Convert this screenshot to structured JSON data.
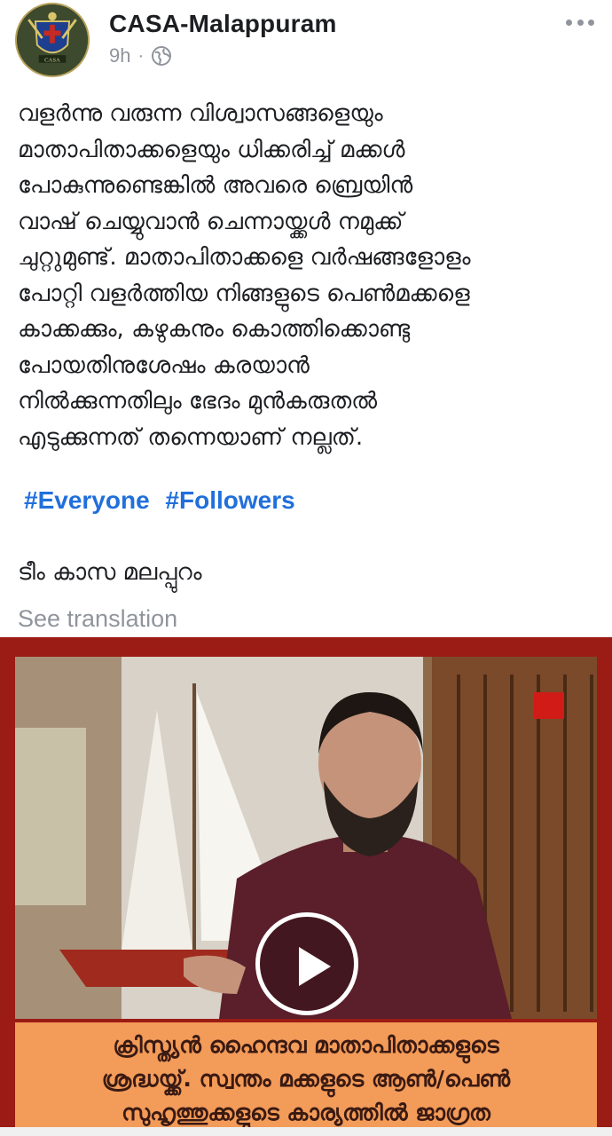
{
  "header": {
    "page_name": "CASA-Malappuram",
    "time": "9h",
    "separator": "·",
    "privacy_icon": "globe-icon",
    "more_icon": "more-horizontal-icon",
    "avatar_text": "CASA"
  },
  "post": {
    "text": "വളർന്നു വരുന്ന വിശ്വാസങ്ങളെയും\nമാതാപിതാക്കളെയും ധിക്കരിച്ച് മക്കൾ\nപോകുന്നുണ്ടെങ്കിൽ അവരെ ബ്രെയിൻ\nവാഷ് ചെയ്യുവാൻ ചെന്നായ്ക്കൾ  നമുക്ക്\nചുറ്റുമുണ്ട്. മാതാപിതാക്കളെ വർഷങ്ങളോളം\nപോറ്റി വളർത്തിയ നിങ്ങളുടെ പെൺമക്കളെ\nകാക്കക്കും, കഴുകനും കൊത്തിക്കൊണ്ടു\nപോയതിനുശേഷം കരയാൻ\nനിൽക്കുന്നതിലും ഭേദം മുൻകരുതൽ\nഎടുക്കുന്നത് തന്നെയാണ് നല്ലത്.",
    "hashtags": [
      "#Everyone",
      "#Followers"
    ],
    "signature": "ടീം കാസ മലപ്പുറം",
    "see_translation": "See translation"
  },
  "video": {
    "play_icon": "play-icon",
    "caption_lines": [
      "ക്രിസ്ത്യൻ ഹൈന്ദവ മാതാപിതാക്കളുടെ",
      "ശ്രദ്ധയ്ക്ക്. സ്വന്തം മക്കളുടെ ആൺ/പെൺ",
      "സുഹൃത്തുക്കളുടെ കാര്യത്തിൽ ജാഗ്രത"
    ]
  },
  "colors": {
    "link_blue": "#216fdb",
    "meta_gray": "#90949c",
    "frame_red": "#9b1c14",
    "caption_orange": "#f39b59"
  }
}
